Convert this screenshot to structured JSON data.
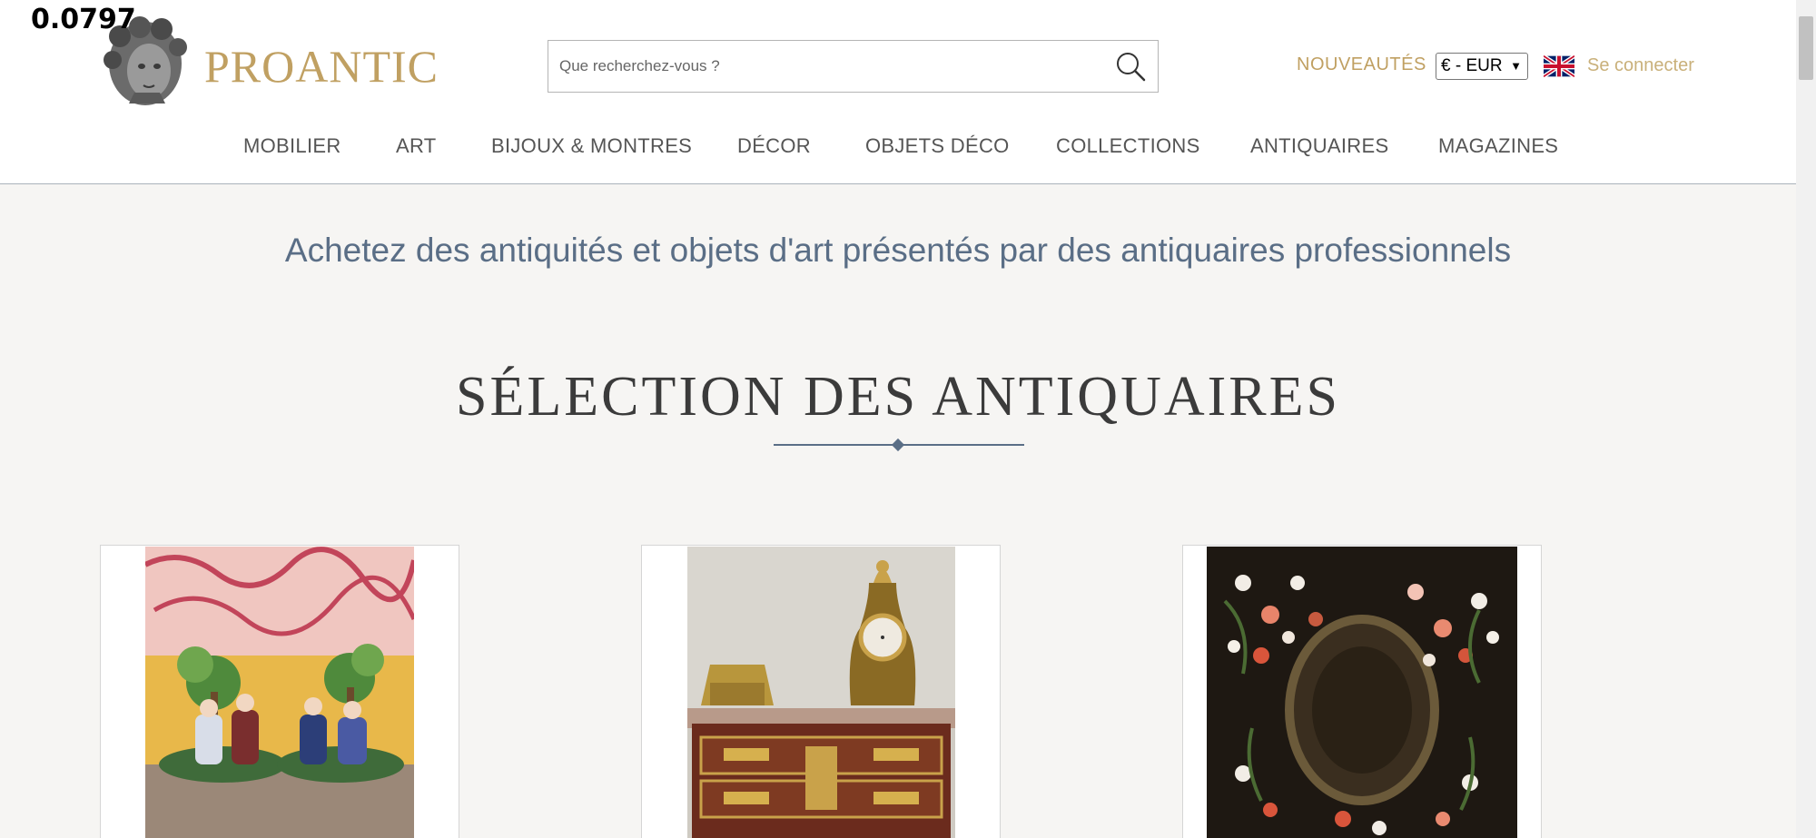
{
  "overlay": {
    "value": "0.0797"
  },
  "header": {
    "brand": "PROANTIC",
    "search": {
      "placeholder": "Que recherchez-vous ?",
      "value": ""
    },
    "new_link": "NOUVEAUTÉS",
    "currency": {
      "selected": "€ - EUR"
    },
    "language_flag": "uk-flag-icon",
    "login": "Se connecter"
  },
  "nav": {
    "items": [
      {
        "label": "MOBILIER"
      },
      {
        "label": "ART"
      },
      {
        "label": "BIJOUX & MONTRES"
      },
      {
        "label": "DÉCOR"
      },
      {
        "label": "OBJETS DÉCO"
      },
      {
        "label": "COLLECTIONS"
      },
      {
        "label": "ANTIQUAIRES"
      },
      {
        "label": "MAGAZINES"
      }
    ]
  },
  "main": {
    "tagline": "Achetez des antiquités et objets d'art présentés par des antiquaires professionnels",
    "section_title": "SÉLECTION DES ANTIQUAIRES"
  },
  "colors": {
    "brand_gold": "#c0a062",
    "tagline_blue": "#5a6e86",
    "background": "#f6f5f3"
  }
}
